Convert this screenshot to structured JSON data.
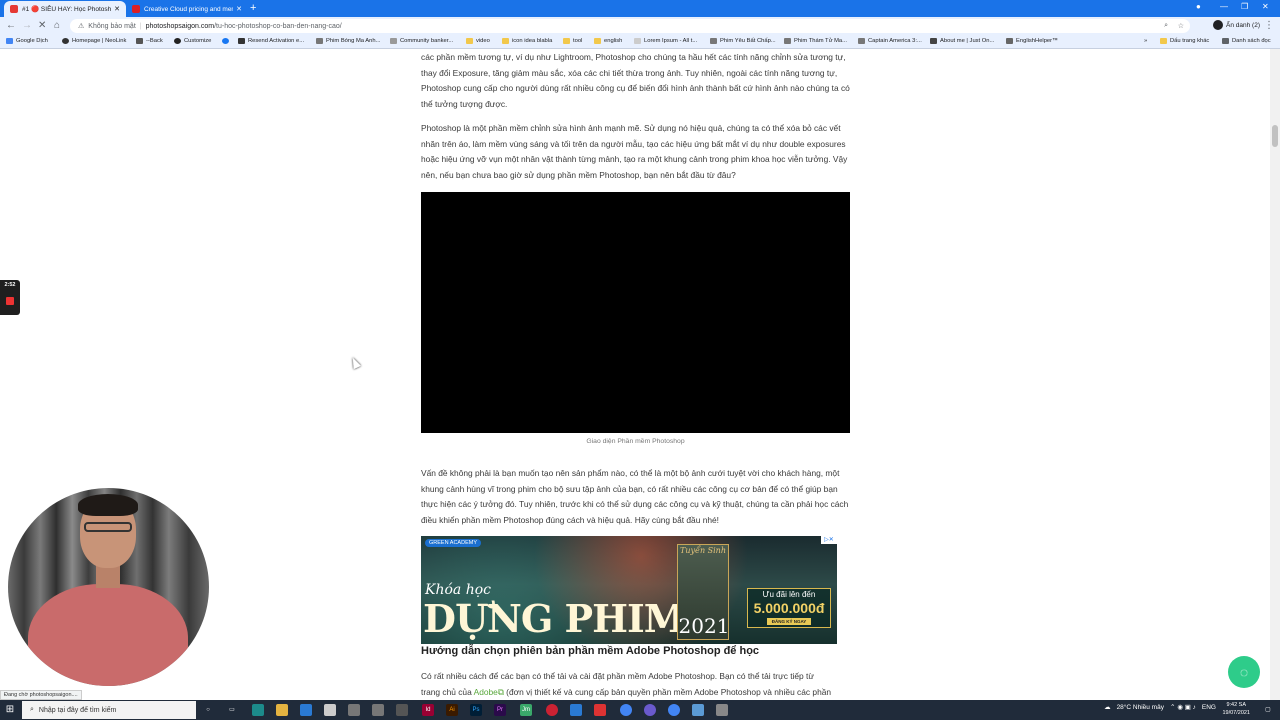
{
  "browser": {
    "tabs": [
      {
        "label": "#1 🔴 SIÊU HAY: Học Photoshop",
        "active": true,
        "favicon_color": "#e53935"
      },
      {
        "label": "Creative Cloud pricing and memb",
        "active": false,
        "favicon_color": "#da1f26"
      }
    ],
    "new_tab_label": "+",
    "address": {
      "security_label": "Không bảo mật",
      "host": "photoshopsaigon.com",
      "path": "/tu-hoc-photoshop-co-ban-den-nang-cao/"
    },
    "profile_label": "Ẩn danh (2)",
    "bookmarks": [
      {
        "label": "Google Dịch",
        "icon": "translate-icon"
      },
      {
        "label": "Homepage | NeoLink",
        "icon": "neolink-icon"
      },
      {
        "label": "--Back",
        "icon": "back-icon"
      },
      {
        "label": "Customize",
        "icon": "customize-icon"
      },
      {
        "label": "",
        "icon": "facebook-icon"
      },
      {
        "label": "Resend Activation e...",
        "icon": "resend-icon"
      },
      {
        "label": "Phim Bóng Ma Anh...",
        "icon": "film-icon"
      },
      {
        "label": "Community banker...",
        "icon": "community-icon"
      },
      {
        "label": "video",
        "icon": "folder-icon"
      },
      {
        "label": "icon idea blabla",
        "icon": "folder-icon"
      },
      {
        "label": "tool",
        "icon": "folder-icon"
      },
      {
        "label": "english",
        "icon": "folder-icon"
      },
      {
        "label": "Lorem Ipsum - All t...",
        "icon": "lorem-icon"
      },
      {
        "label": "Phim Yêu Bất Chấp...",
        "icon": "film-icon"
      },
      {
        "label": "Phim Thám Tử Ma...",
        "icon": "film-icon"
      },
      {
        "label": "Captain America 3:...",
        "icon": "film-icon"
      },
      {
        "label": "About me | Just On...",
        "icon": "plane-icon"
      },
      {
        "label": "EnglishHelper™",
        "icon": "english-helper-icon"
      },
      {
        "label": "Dấu trang khác",
        "icon": "folder-icon"
      },
      {
        "label": "Danh sách đọc",
        "icon": "reading-list-icon"
      }
    ]
  },
  "article": {
    "para1": "các phần mềm tương tự, ví dụ như Lightroom, Photoshop cho chúng ta hầu hết các tính năng chỉnh sửa tương tự, thay đổi Exposure, tăng giảm màu sắc, xóa các chi tiết thừa trong ảnh. Tuy nhiên, ngoài các tính năng tương tự, Photoshop cung cấp cho người dùng rất nhiều công cụ để biến đổi hình ảnh thành bất cứ hình ảnh nào chúng ta có thể tưởng tượng được.",
    "para2": "Photoshop là một phần mềm chỉnh sửa hình ảnh mạnh mẽ. Sử dụng nó hiệu quả, chúng ta có thể xóa bỏ các vết nhăn trên áo, làm mềm vùng sáng và tối trên da người mẫu, tạo các hiệu ứng bất mắt ví dụ như double exposures hoặc hiệu ứng vỡ vụn một nhân vật thành từng mảnh, tạo ra một khung cảnh trong phim khoa học viễn tưởng. Vậy nên, nếu bạn chưa bao giờ sử dụng phần mềm Photoshop, bạn nên bắt đầu từ đâu?",
    "video_caption": "Giao diện Phần mềm Photoshop",
    "para3": "Vấn đề không phải là bạn muốn tạo nên sản phẩm nào, có thể là một bộ ảnh cưới tuyệt vời cho khách hàng, một khung cảnh hùng vĩ trong phim cho bộ sưu tập ảnh của bạn, có rất nhiều các công cụ cơ bản để có thể giúp bạn thực hiện các ý tưởng đó. Tuy nhiên, trước khi có thể sử dụng các công cụ và kỹ thuật, chúng ta cần phải học cách điều khiển phần mềm Photoshop đúng cách và hiệu quả. Hãy cùng bắt đầu nhé!",
    "ad": {
      "badge": "GREEN ACADEMY",
      "line1": "Khóa học",
      "line2": "DỰNG PHIM",
      "poster_title": "Tuyển Sinh",
      "year": "2021",
      "offer_line1": "Ưu đãi lên đến",
      "offer_line2": "5.000.000đ",
      "offer_cta": "ĐĂNG KÝ NGAY",
      "close_label": "▷✕"
    },
    "heading": "Hướng dẫn chọn phiên bản phần mềm Adobe Photoshop để học",
    "para4_line1": "Có rất nhiều cách để các bạn có thể tải và cài đặt phần mềm Adobe Photoshop. Bạn có thể tải trực tiếp từ",
    "para4_line2_pre": "trang chủ của",
    "para4_link": "Adobe",
    "para4_line2_post": "(đơn vị thiết kế và cung cấp bản quyền phần mềm Adobe Photoshop và nhiều các phần"
  },
  "overlays": {
    "rec_time": "2:52",
    "status_hint": "Đang chờ photoshopsaigon...."
  },
  "taskbar": {
    "search_placeholder": "Nhập tại đây để tìm kiếm",
    "weather": "28°C  Nhiều mây",
    "language": "ENG",
    "time": "9:42 SA",
    "date": "19/07/2021"
  }
}
